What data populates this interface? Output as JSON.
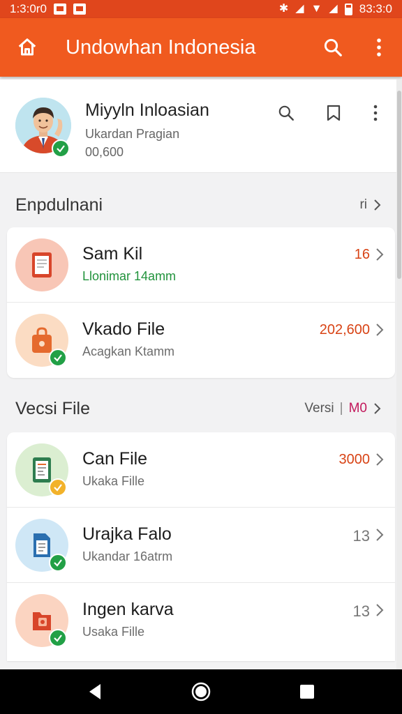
{
  "status_bar": {
    "time_left": "1:3:0r0",
    "time_right": "83:3:0"
  },
  "app_bar": {
    "title": "Undowhan Indonesia",
    "icons": [
      "home-icon",
      "search-icon",
      "more-vert-icon"
    ]
  },
  "profile": {
    "name": "Miyyln Inloasian",
    "subtitle": "Ukardan Pragian",
    "number": "00,600",
    "icons": [
      "search-icon",
      "bookmark-icon",
      "more-vert-icon"
    ]
  },
  "section1": {
    "title": "Enpdulnani",
    "link": "ri",
    "rows": [
      {
        "title": "Sam Kil",
        "subtitle": "Llonimar 14amm",
        "value": "16",
        "icon": "document-icon",
        "icon_bg": "#f8c6b6",
        "badge": ""
      },
      {
        "title": "Vkado File",
        "subtitle": "Acagkan Ktamm",
        "value": "202,600",
        "icon": "shopping-bag-icon",
        "icon_bg": "#fbdcc3",
        "badge": "check-icon"
      }
    ]
  },
  "section2": {
    "title": "Vecsi File",
    "link_text": "Versi",
    "link_accent": "M0",
    "rows": [
      {
        "title": "Can File",
        "subtitle": "Ukaka Fille",
        "value": "3000",
        "icon": "form-document-icon",
        "icon_bg": "#dbeed1",
        "badge": "check-icon",
        "badge_color": "#f2b22a"
      },
      {
        "title": "Urajka Falo",
        "subtitle": "Ukandar 16atrm",
        "value": "13",
        "icon": "file-icon",
        "icon_bg": "#cfe7f6",
        "badge": "check-icon",
        "badge_color": "#22a046"
      },
      {
        "title": "Ingen karva",
        "subtitle": "Usaka Fille",
        "value": "13",
        "icon": "folder-icon",
        "icon_bg": "#fbd4c1",
        "badge": "check-icon",
        "badge_color": "#22a046"
      }
    ]
  },
  "colors": {
    "app_bar": "#f05a1f",
    "status_bar": "#e0461c",
    "value_red": "#d84315",
    "badge_green": "#22a046",
    "badge_yellow": "#f2b22a"
  },
  "nav_bar": {
    "icons": [
      "back-icon",
      "home-circle-icon",
      "recents-icon"
    ]
  }
}
